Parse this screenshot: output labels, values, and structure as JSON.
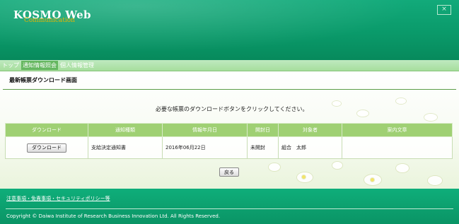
{
  "header": {
    "logo_main": "KOSMO Web",
    "logo_sub": "Communication",
    "close_glyph": "×"
  },
  "nav": {
    "items": [
      {
        "label": "トップ"
      },
      {
        "label": "通知情報照会",
        "active": true
      },
      {
        "label": "個人情報管理"
      }
    ]
  },
  "page": {
    "title": "最新帳票ダウンロード画面",
    "instruction": "必要な帳票のダウンロードボタンをクリックしてください。"
  },
  "table": {
    "headers": [
      "ダウンロード",
      "通知種類",
      "情報年月日",
      "開封日",
      "対象者",
      "案内文章"
    ],
    "rows": [
      {
        "download_label": "ダウンロード",
        "type": "支給決定通知書",
        "date": "2016年06月22日",
        "opened": "未開封",
        "person": "組合　太郎",
        "message": ""
      }
    ]
  },
  "back_button": "戻る",
  "footer": {
    "link": "注意事項・免責事項・セキュリティポリシー等",
    "copyright": "Copyright © Daiwa Institute of Research Business Innovation Ltd. All Rights Reserved."
  },
  "colors": {
    "header_green": "#0a9a6a",
    "nav_green": "#a6de9c",
    "table_header": "#9fd073",
    "logo_accent": "#e6b400"
  },
  "icons": {
    "close": "close-icon"
  }
}
